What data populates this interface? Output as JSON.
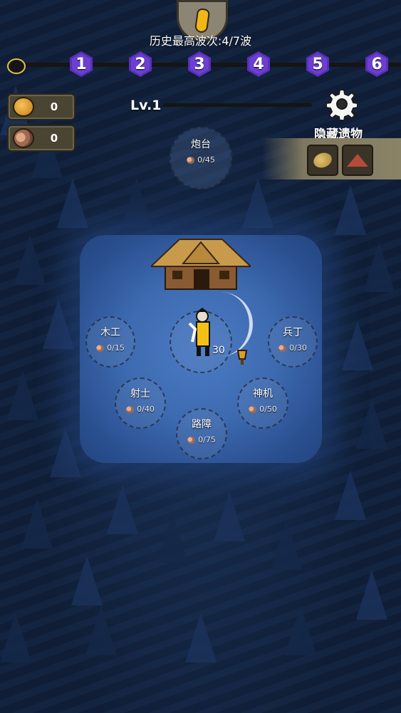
{
  "header": {
    "best_wave_text": "历史最高波次:4/7波",
    "waves": [
      "1",
      "2",
      "3",
      "4",
      "5",
      "6"
    ],
    "level": "Lv.1"
  },
  "resources": {
    "gold": {
      "icon": "gold-coin-icon",
      "value": "0"
    },
    "wood": {
      "icon": "seed-icon",
      "value": "0"
    }
  },
  "hidden_relics": {
    "title": "隐藏遗物",
    "items": [
      {
        "icon": "potato-icon"
      },
      {
        "icon": "red-powder-icon"
      }
    ]
  },
  "buildings": [
    {
      "name": "炮台",
      "cost": "0/45"
    },
    {
      "name": "木工",
      "cost": "0/15"
    },
    {
      "name": "兵丁",
      "cost": "0/30"
    },
    {
      "name": "射士",
      "cost": "0/40"
    },
    {
      "name": "神机",
      "cost": "0/50"
    },
    {
      "name": "路障",
      "cost": "0/75"
    }
  ],
  "hero": {
    "cost_partial": "30"
  },
  "colors": {
    "accent_purple": "#6b3fd0",
    "clearing": "#3d6ab0",
    "gold": "#f2b716"
  }
}
